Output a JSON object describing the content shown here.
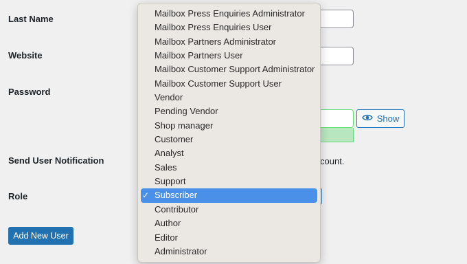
{
  "form": {
    "labels": {
      "last_name": "Last Name",
      "website": "Website",
      "password": "Password",
      "send_notification": "Send User Notification",
      "role": "Role"
    },
    "show_button": "Show",
    "notification_tail": "count.",
    "add_button": "Add New User"
  },
  "role_dropdown": {
    "selected": "Subscriber",
    "options": [
      "Mailbox Press Enquiries Administrator",
      "Mailbox Press Enquiries User",
      "Mailbox Partners Administrator",
      "Mailbox Partners User",
      "Mailbox Customer Support Administrator",
      "Mailbox Customer Support User",
      "Vendor",
      "Pending Vendor",
      "Shop manager",
      "Customer",
      "Analyst",
      "Sales",
      "Support",
      "Subscriber",
      "Contributor",
      "Author",
      "Editor",
      "Administrator"
    ]
  },
  "colors": {
    "accent": "#2271b1",
    "selection": "#4a90e8",
    "strength_good": "#b8e6bf"
  },
  "icons": {
    "show": "eye-icon",
    "selected_marker": "checkmark-icon"
  }
}
